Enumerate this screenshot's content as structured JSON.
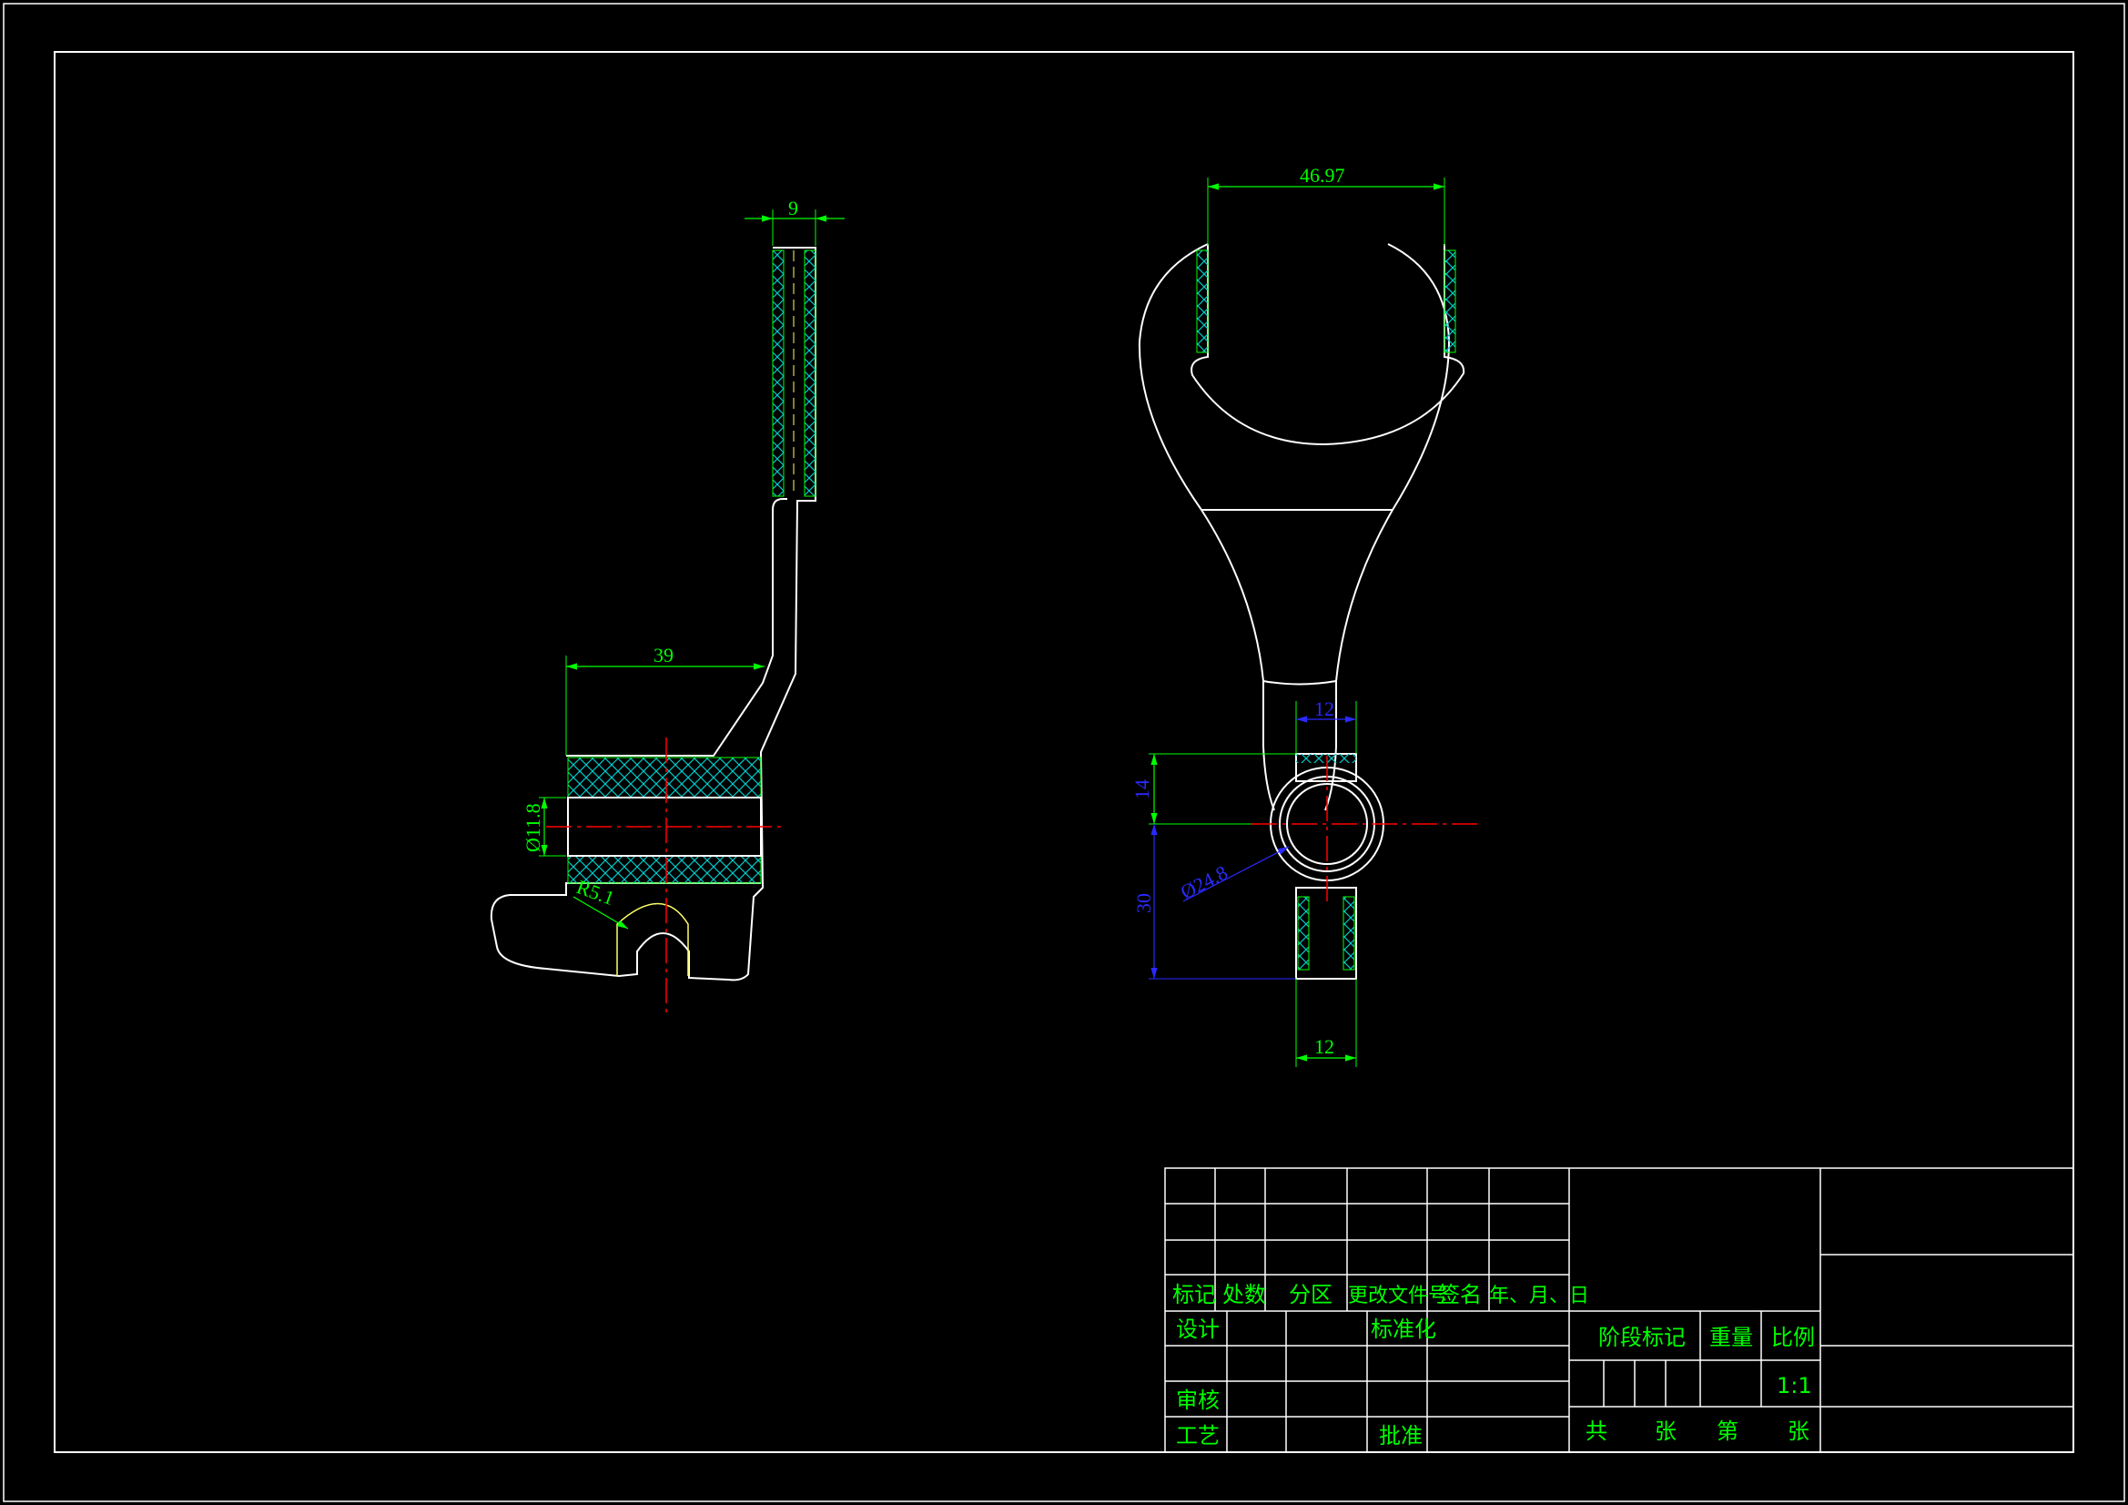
{
  "colors": {
    "background": "#000000",
    "outline": "#ffffff",
    "dimension_green": "#00ff00",
    "dimension_blue": "#2a2aff",
    "centerline_red": "#ff0000",
    "hatch_cyan": "#00c8c8",
    "hidden_yellow": "#ffff66"
  },
  "side_view": {
    "dim_width": "9",
    "dim_length": "39",
    "dim_bore": "Ø11.8",
    "dim_radius": "R5.1"
  },
  "front_view": {
    "dim_opening": "46.97",
    "dim_slot_top": "12",
    "dim_offset": "14",
    "dim_bore": "Ø24.8",
    "dim_height": "30",
    "dim_slot_bottom": "12"
  },
  "title_block": {
    "headers": [
      "标记",
      "处数",
      "分区",
      "更改文件号",
      "签名",
      "年、月、日"
    ],
    "design": "设计",
    "standardization": "标准化",
    "review": "审核",
    "process": "工艺",
    "approval": "批准",
    "stage_mark": "阶段标记",
    "weight": "重量",
    "scale_label": "比例",
    "scale_value": "1:1",
    "total": "共",
    "sheets": "张",
    "sheet_no": "第",
    "sheets2": "张"
  }
}
